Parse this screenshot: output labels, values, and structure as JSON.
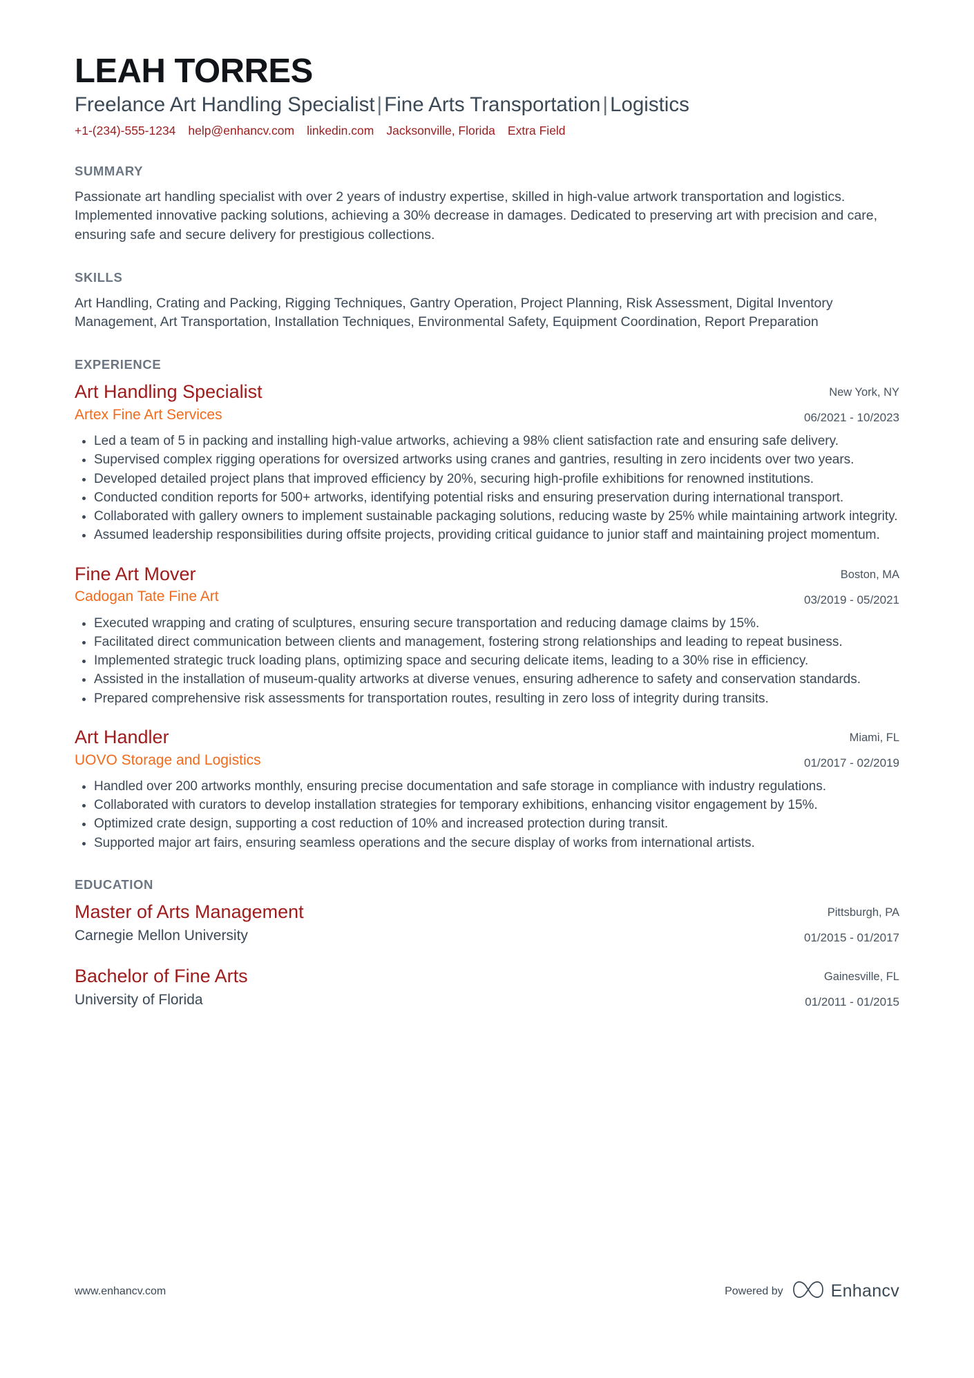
{
  "header": {
    "name": "LEAH TORRES",
    "headline_parts": [
      "Freelance Art Handling Specialist",
      "Fine Arts Transportation",
      "Logistics"
    ],
    "headline_separator": "|",
    "contact": [
      {
        "name": "phone",
        "text": "+1-(234)-555-1234"
      },
      {
        "name": "email",
        "text": "help@enhancv.com"
      },
      {
        "name": "linkedin",
        "text": "linkedin.com"
      },
      {
        "name": "location",
        "text": "Jacksonville, Florida"
      },
      {
        "name": "extra-field",
        "text": "Extra Field"
      }
    ]
  },
  "summary": {
    "title": "SUMMARY",
    "text": "Passionate art handling specialist with over 2 years of industry expertise, skilled in high-value artwork transportation and logistics. Implemented innovative packing solutions, achieving a 30% decrease in damages. Dedicated to preserving art with precision and care, ensuring safe and secure delivery for prestigious collections."
  },
  "skills": {
    "title": "SKILLS",
    "text": "Art Handling, Crating and Packing, Rigging Techniques, Gantry Operation, Project Planning, Risk Assessment, Digital Inventory Management, Art Transportation, Installation Techniques, Environmental Safety, Equipment Coordination, Report Preparation"
  },
  "experience": {
    "title": "EXPERIENCE",
    "entries": [
      {
        "job_title": "Art Handling Specialist",
        "company": "Artex Fine Art Services",
        "location": "New York, NY",
        "dates": "06/2021 - 10/2023",
        "bullets": [
          "Led a team of 5 in packing and installing high-value artworks, achieving a 98% client satisfaction rate and ensuring safe delivery.",
          "Supervised complex rigging operations for oversized artworks using cranes and gantries, resulting in zero incidents over two years.",
          "Developed detailed project plans that improved efficiency by 20%, securing high-profile exhibitions for renowned institutions.",
          "Conducted condition reports for 500+ artworks, identifying potential risks and ensuring preservation during international transport.",
          "Collaborated with gallery owners to implement sustainable packaging solutions, reducing waste by 25% while maintaining artwork integrity.",
          "Assumed leadership responsibilities during offsite projects, providing critical guidance to junior staff and maintaining project momentum."
        ]
      },
      {
        "job_title": "Fine Art Mover",
        "company": "Cadogan Tate Fine Art",
        "location": "Boston, MA",
        "dates": "03/2019 - 05/2021",
        "bullets": [
          "Executed wrapping and crating of sculptures, ensuring secure transportation and reducing damage claims by 15%.",
          "Facilitated direct communication between clients and management, fostering strong relationships and leading to repeat business.",
          "Implemented strategic truck loading plans, optimizing space and securing delicate items, leading to a 30% rise in efficiency.",
          "Assisted in the installation of museum-quality artworks at diverse venues, ensuring adherence to safety and conservation standards.",
          "Prepared comprehensive risk assessments for transportation routes, resulting in zero loss of integrity during transits."
        ]
      },
      {
        "job_title": "Art Handler",
        "company": "UOVO Storage and Logistics",
        "location": "Miami, FL",
        "dates": "01/2017 - 02/2019",
        "bullets": [
          "Handled over 200 artworks monthly, ensuring precise documentation and safe storage in compliance with industry regulations.",
          "Collaborated with curators to develop installation strategies for temporary exhibitions, enhancing visitor engagement by 15%.",
          "Optimized crate design, supporting a cost reduction of 10% and increased protection during transit.",
          "Supported major art fairs, ensuring seamless operations and the secure display of works from international artists."
        ]
      }
    ]
  },
  "education": {
    "title": "EDUCATION",
    "entries": [
      {
        "degree": "Master of Arts Management",
        "school": "Carnegie Mellon University",
        "location": "Pittsburgh, PA",
        "dates": "01/2015 - 01/2017"
      },
      {
        "degree": "Bachelor of Fine Arts",
        "school": "University of Florida",
        "location": "Gainesville, FL",
        "dates": "01/2011 - 01/2015"
      }
    ]
  },
  "footer": {
    "url": "www.enhancv.com",
    "powered_by": "Powered by",
    "brand": "Enhancv"
  },
  "colors": {
    "accent_red": "#9e1b1b",
    "accent_orange": "#f26a1b",
    "contact_red": "#9b1d1d",
    "section_heading": "#6b7682",
    "body": "#3b4957"
  }
}
